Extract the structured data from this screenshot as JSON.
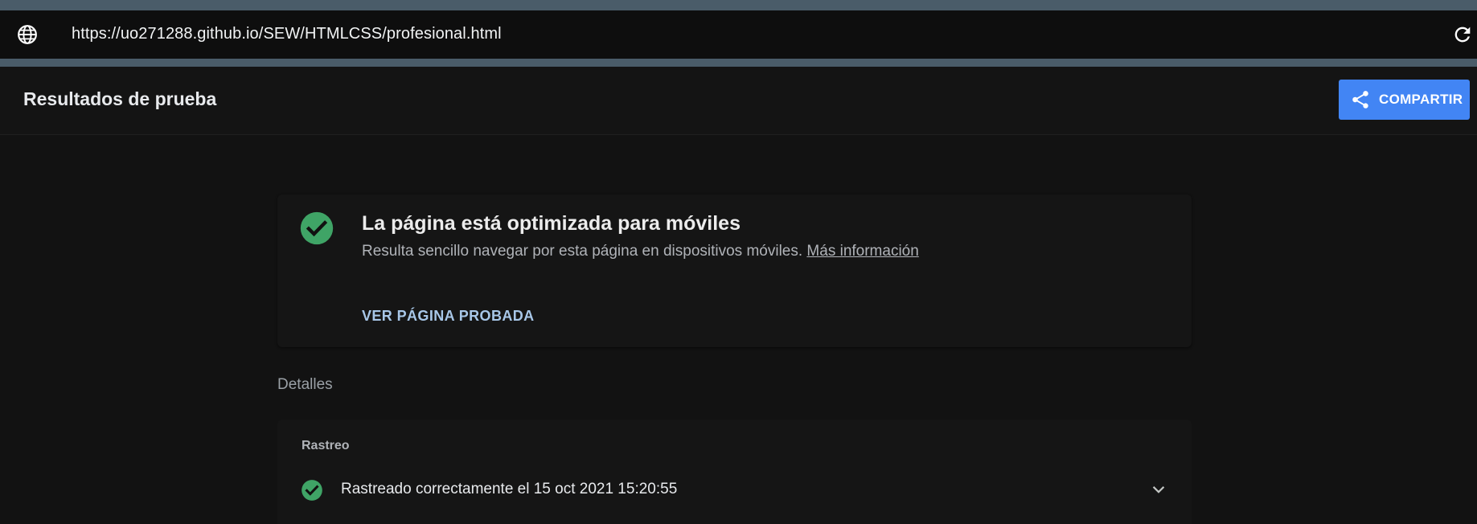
{
  "browser": {
    "url": "https://uo271288.github.io/SEW/HTMLCSS/profesional.html",
    "globe_icon": "globe-icon",
    "reload_icon": "reload-icon"
  },
  "header": {
    "title": "Resultados de prueba",
    "share_label": "COMPARTIR",
    "share_icon": "share-icon",
    "accent_color": "#4285f4"
  },
  "result_card": {
    "headline": "La página está optimizada para móviles",
    "description": "Resulta sencillo navegar por esta página en dispositivos móviles.",
    "more_info_link": "Más información",
    "view_button": "VER PÁGINA PROBADA",
    "status_color": "#3fa466"
  },
  "details": {
    "label": "Detalles",
    "section_title": "Rastreo",
    "crawl_status": "Rastreado correctamente el 15 oct 2021 15:20:55",
    "expand_icon": "chevron-down-icon"
  }
}
